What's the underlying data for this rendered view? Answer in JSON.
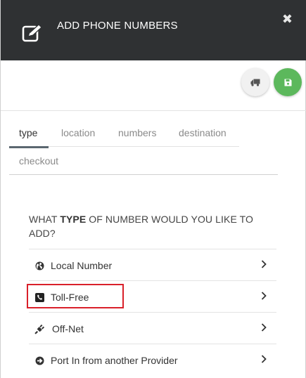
{
  "header": {
    "title": "ADD PHONE NUMBERS",
    "close_glyph": "✖",
    "icon": "edit-icon"
  },
  "toolbar": {
    "ship_button_icon": "shipping-icon",
    "save_button_icon": "save-icon",
    "save_button_color": "#5cb85c"
  },
  "tabs": [
    {
      "label": "type",
      "active": true
    },
    {
      "label": "location",
      "active": false
    },
    {
      "label": "numbers",
      "active": false
    },
    {
      "label": "destination",
      "active": false
    },
    {
      "label": "checkout",
      "active": false
    }
  ],
  "question": {
    "prefix": "WHAT ",
    "emphasis": "TYPE",
    "suffix": " OF NUMBER WOULD YOU LIKE TO ADD?"
  },
  "options": [
    {
      "label": "Local Number",
      "icon": "globe-icon"
    },
    {
      "label": "Toll-Free",
      "icon": "phone-icon",
      "highlighted": true
    },
    {
      "label": "Off-Net",
      "icon": "plug-icon"
    },
    {
      "label": "Port In from another Provider",
      "icon": "arrow-circle-right-icon"
    }
  ],
  "colors": {
    "header_bg": "#2f3133",
    "highlight_border": "#d9202a",
    "active_tab_underline": "#5b6770"
  }
}
